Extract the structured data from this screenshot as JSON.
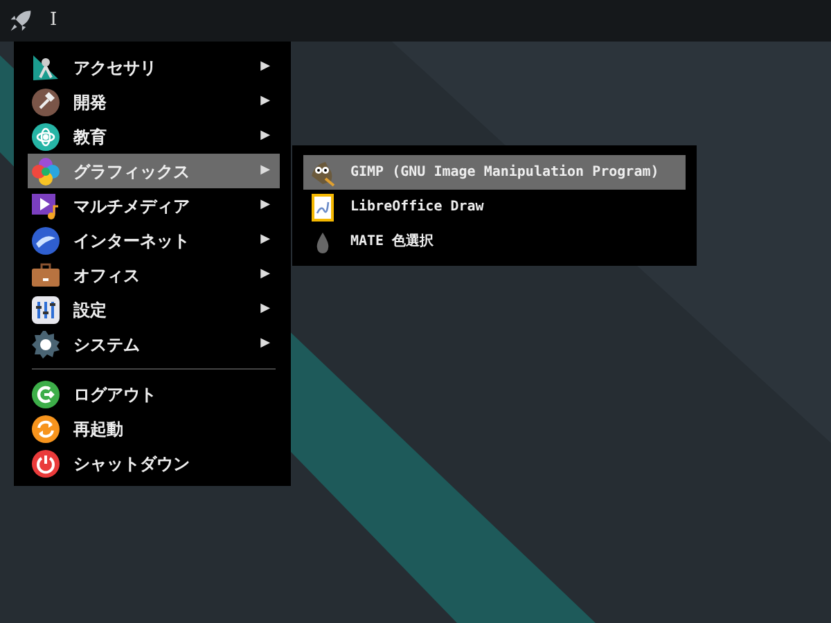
{
  "panel": {
    "text": "I"
  },
  "menu": {
    "items": [
      {
        "label": "アクセサリ",
        "arrow": "▶",
        "selected": false
      },
      {
        "label": "開発",
        "arrow": "▶",
        "selected": false
      },
      {
        "label": "教育",
        "arrow": "▶",
        "selected": false
      },
      {
        "label": "グラフィックス",
        "arrow": "▶",
        "selected": true
      },
      {
        "label": "マルチメディア",
        "arrow": "▶",
        "selected": false
      },
      {
        "label": "インターネット",
        "arrow": "▶",
        "selected": false
      },
      {
        "label": "オフィス",
        "arrow": "▶",
        "selected": false
      },
      {
        "label": "設定",
        "arrow": "▶",
        "selected": false
      },
      {
        "label": "システム",
        "arrow": "▶",
        "selected": false
      }
    ],
    "actions": [
      {
        "label": "ログアウト"
      },
      {
        "label": "再起動"
      },
      {
        "label": "シャットダウン"
      }
    ]
  },
  "submenu": {
    "items": [
      {
        "label": "GIMP (GNU Image Manipulation Program)",
        "selected": true
      },
      {
        "label": "LibreOffice Draw",
        "selected": false
      },
      {
        "label": "MATE 色選択",
        "selected": false
      }
    ]
  }
}
